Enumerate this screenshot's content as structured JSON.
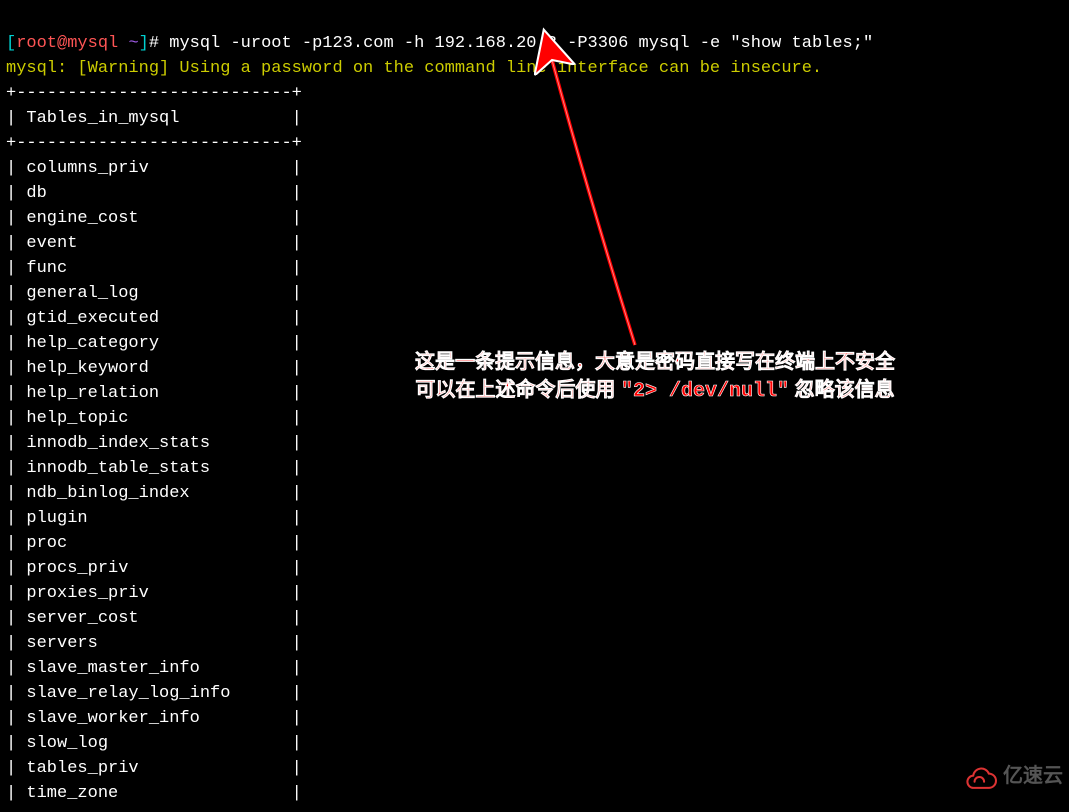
{
  "prompt": {
    "open": "[",
    "user": "root@mysql",
    "space": " ",
    "tilde": "~",
    "close": "]",
    "hash": "#",
    "command": "mysql -uroot -p123.com -h 192.168.20.2 -P3306 mysql -e \"show tables;\""
  },
  "warning": "mysql: [Warning] Using a password on the command line interface can be insecure.",
  "table": {
    "border_top": "+---------------------------+",
    "header_line": "| Tables_in_mysql           |",
    "border_mid": "+---------------------------+",
    "rows": [
      "| columns_priv              |",
      "| db                        |",
      "| engine_cost               |",
      "| event                     |",
      "| func                      |",
      "| general_log               |",
      "| gtid_executed             |",
      "| help_category             |",
      "| help_keyword              |",
      "| help_relation             |",
      "| help_topic                |",
      "| innodb_index_stats        |",
      "| innodb_table_stats        |",
      "| ndb_binlog_index          |",
      "| plugin                    |",
      "| proc                      |",
      "| procs_priv                |",
      "| proxies_priv              |",
      "| server_cost               |",
      "| servers                   |",
      "| slave_master_info         |",
      "| slave_relay_log_info      |",
      "| slave_worker_info         |",
      "| slow_log                  |",
      "| tables_priv               |",
      "| time_zone                 |"
    ]
  },
  "annotation": {
    "line1": "这是一条提示信息，大意是密码直接写在终端上不安全",
    "line2_prefix": "可以在上述命令后使用 ",
    "line2_quote": "\"2> /dev/null\"",
    "line2_suffix": " 忽略该信息"
  },
  "watermark": {
    "text": "亿速云"
  },
  "chart_data": {
    "type": "table",
    "title": "Tables_in_mysql",
    "columns": [
      "Tables_in_mysql"
    ],
    "rows": [
      [
        "columns_priv"
      ],
      [
        "db"
      ],
      [
        "engine_cost"
      ],
      [
        "event"
      ],
      [
        "func"
      ],
      [
        "general_log"
      ],
      [
        "gtid_executed"
      ],
      [
        "help_category"
      ],
      [
        "help_keyword"
      ],
      [
        "help_relation"
      ],
      [
        "help_topic"
      ],
      [
        "innodb_index_stats"
      ],
      [
        "innodb_table_stats"
      ],
      [
        "ndb_binlog_index"
      ],
      [
        "plugin"
      ],
      [
        "proc"
      ],
      [
        "procs_priv"
      ],
      [
        "proxies_priv"
      ],
      [
        "server_cost"
      ],
      [
        "servers"
      ],
      [
        "slave_master_info"
      ],
      [
        "slave_relay_log_info"
      ],
      [
        "slave_worker_info"
      ],
      [
        "slow_log"
      ],
      [
        "tables_priv"
      ],
      [
        "time_zone"
      ]
    ]
  }
}
